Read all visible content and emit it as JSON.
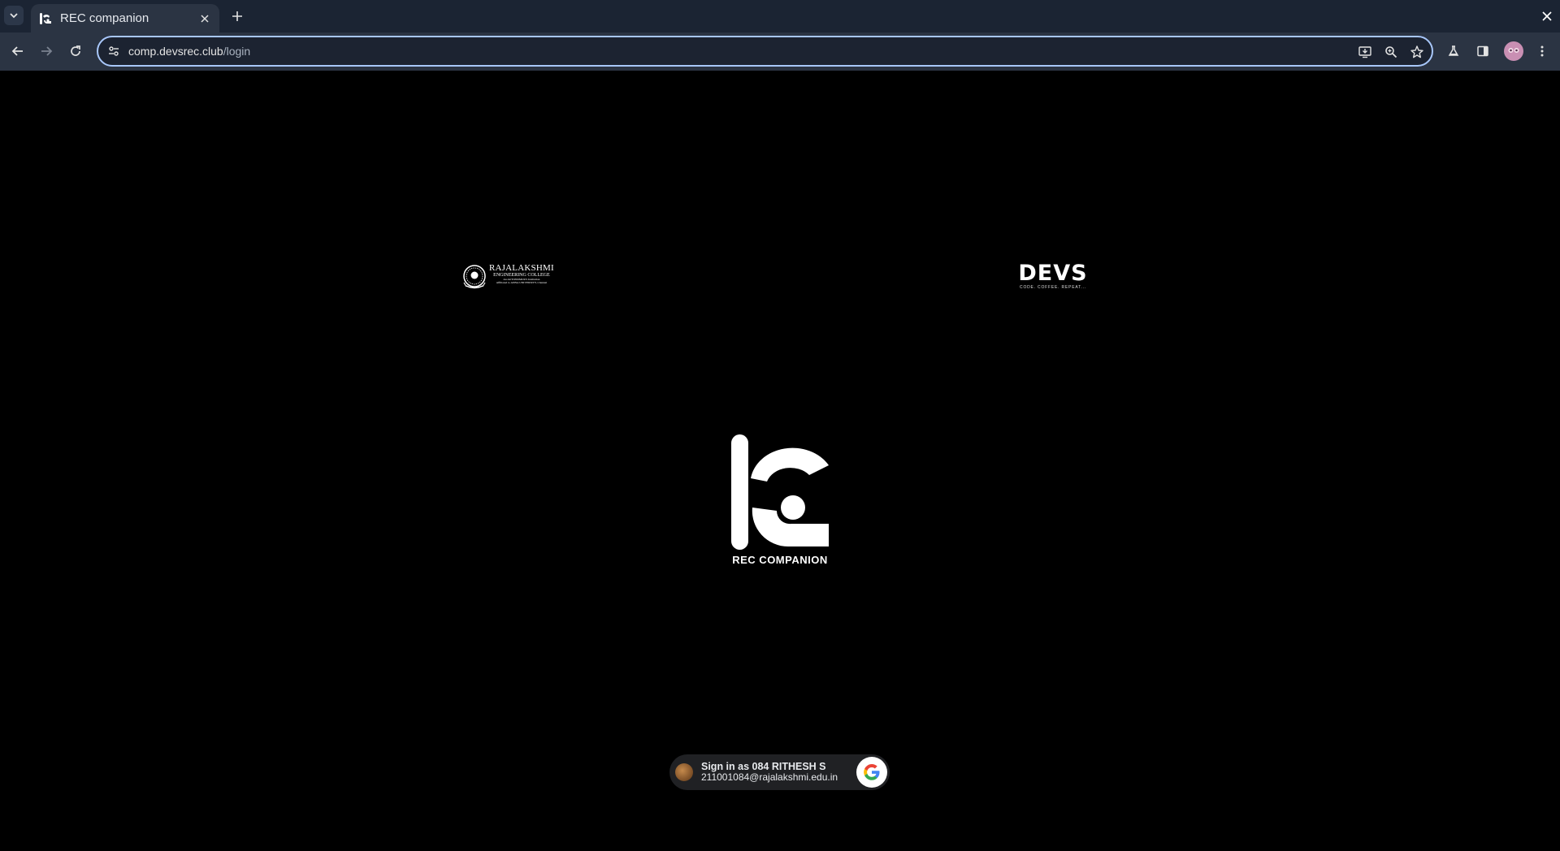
{
  "browser": {
    "tab": {
      "title": "REC companion"
    },
    "omnibox": {
      "domain": "comp.devsrec.club",
      "path": "/login"
    }
  },
  "page": {
    "college_logo": {
      "name": "RAJALAKSHMI",
      "subtitle": "ENGINEERING COLLEGE",
      "line1": "An AUTONOMOUS Institution",
      "line2": "Affiliated to ANNA UNIVERSITY, Chennai"
    },
    "devs_logo": {
      "word": "DEVS",
      "tagline": "CODE. COFFEE. REPEAT..."
    },
    "app": {
      "name": "REC COMPANION"
    },
    "signin": {
      "label": "Sign in as 084 RITHESH S",
      "email": "211001084@rajalakshmi.edu.in"
    }
  },
  "colors": {
    "tabstrip": "#1b2433",
    "toolbar": "#2b3443",
    "omnibox_border": "#a8c7fa",
    "page_background": "#000000"
  }
}
